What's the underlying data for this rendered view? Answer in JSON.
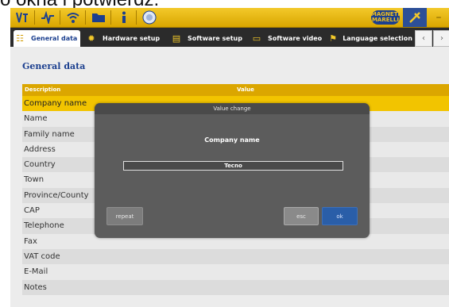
{
  "caption": "o okna i potwierdź.",
  "toolbar": {
    "icons": [
      "vehicle-diagnosis-icon",
      "signal-icon",
      "wifi-icon",
      "folder-icon",
      "info-icon",
      "globe-icon"
    ],
    "brand": "MAGNETI MARELLI",
    "tools_icon": "tools-icon"
  },
  "tabs": [
    {
      "label": "General data",
      "icon": "general-data-icon"
    },
    {
      "label": "Hardware setup",
      "icon": "gear-icon"
    },
    {
      "label": "Software setup",
      "icon": "document-icon"
    },
    {
      "label": "Software video",
      "icon": "video-icon"
    },
    {
      "label": "Language selection",
      "icon": "flag-icon"
    }
  ],
  "nav": {
    "prev": "‹",
    "next": "›"
  },
  "page_title": "General data",
  "table": {
    "headers": {
      "description": "Description",
      "value": "Value"
    },
    "rows": [
      "Company name",
      "Name",
      "Family name",
      "Address",
      "Country",
      "Town",
      "Province/County",
      "CAP",
      "Telephone",
      "Fax",
      "VAT code",
      "E-Mail",
      "Notes"
    ],
    "selected_index": 0
  },
  "dialog": {
    "title": "Value change",
    "field_label": "Company name",
    "field_value": "Tecno",
    "buttons": {
      "repeat": "repeat",
      "esc": "esc",
      "ok": "ok"
    }
  },
  "colors": {
    "accent_yellow": "#f2c400",
    "header_gold": "#dba600",
    "brand_blue": "#1b3f8f",
    "ok_blue": "#2a5ea8",
    "dialog_gray": "#5c5c5c"
  }
}
